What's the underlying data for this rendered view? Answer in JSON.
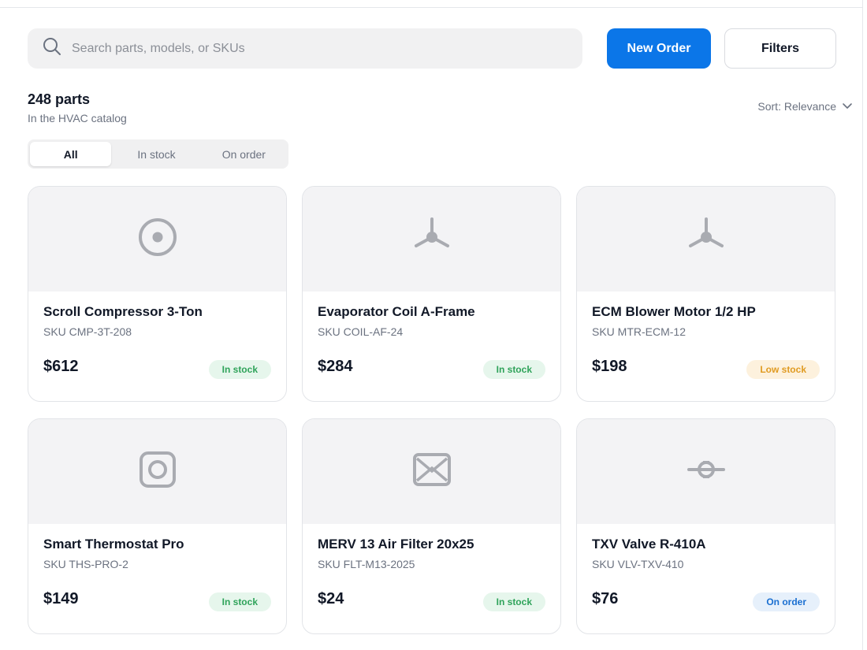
{
  "search": {
    "placeholder": "Search parts, models, or SKUs",
    "icon": "search-icon"
  },
  "actions": {
    "new_order": "New Order",
    "filters": "Filters",
    "primary_color": "#0b76e8"
  },
  "summary": {
    "count": "248 parts",
    "subtitle": "In the HVAC catalog"
  },
  "sort": {
    "label": "Sort: Relevance",
    "icon": "chevron-down-icon"
  },
  "tabs": [
    {
      "label": "All",
      "active": true
    },
    {
      "label": "In stock",
      "active": false
    },
    {
      "label": "On order",
      "active": false
    }
  ],
  "products": [
    {
      "title": "Scroll Compressor 3-Ton",
      "sku": "SKU CMP-3T-208",
      "price": "$612",
      "status": "In stock",
      "icon": "compressor-icon"
    },
    {
      "title": "Evaporator Coil A-Frame",
      "sku": "SKU COIL-AF-24",
      "price": "$284",
      "status": "In stock",
      "icon": "fan-icon"
    },
    {
      "title": "ECM Blower Motor 1/2 HP",
      "sku": "SKU MTR-ECM-12",
      "price": "$198",
      "status": "Low stock",
      "icon": "fan-icon"
    },
    {
      "title": "Smart Thermostat Pro",
      "sku": "SKU THS-PRO-2",
      "price": "$149",
      "status": "In stock",
      "icon": "thermostat-icon"
    },
    {
      "title": "MERV 13 Air Filter 20x25",
      "sku": "SKU FLT-M13-2025",
      "price": "$24",
      "status": "In stock",
      "icon": "filter-icon"
    },
    {
      "title": "TXV Valve R-410A",
      "sku": "SKU VLV-TXV-410",
      "price": "$76",
      "status": "On order",
      "icon": "valve-icon"
    }
  ],
  "status_colors": {
    "in_stock": "#2fa35a",
    "low_stock": "#e09b22",
    "on_order": "#1a6fd1"
  }
}
